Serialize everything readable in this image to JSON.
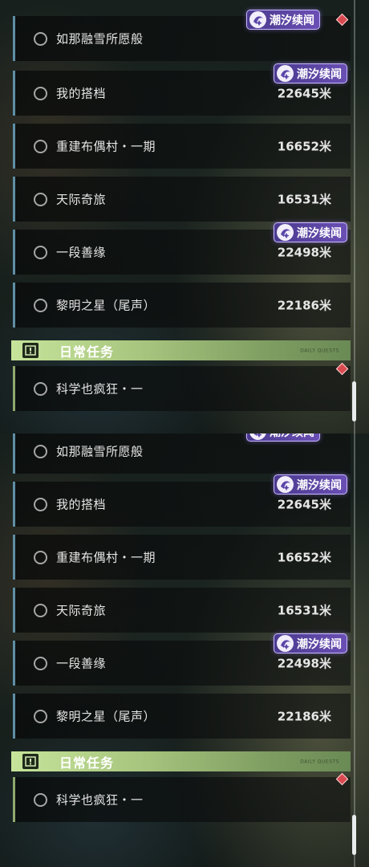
{
  "badge_label": "潮汐续闻",
  "distance_unit": "米",
  "quests": [
    {
      "title": "如那融雪所愿般",
      "distance": ""
    },
    {
      "title": "我的搭档",
      "distance": "22645"
    },
    {
      "title": "重建布偶村・一期",
      "distance": "16652"
    },
    {
      "title": "天际奇旅",
      "distance": "16531"
    },
    {
      "title": "一段善缘",
      "distance": "22498"
    },
    {
      "title": "黎明之星（尾声）",
      "distance": "22186"
    }
  ],
  "daily_section": {
    "title": "日常任务",
    "tag": "DAILY QUESTS"
  },
  "daily_quests": [
    {
      "title": "科学也疯狂・一"
    }
  ],
  "colors": {
    "main_quest_accent": "#5f8fa6",
    "daily_accent": "#8fa96e",
    "badge_purple": "#6a4fb4",
    "tracked_marker": "#d94a50"
  },
  "icons": [
    "tidal-story-logo-icon",
    "tracked-diamond-icon",
    "quest-circle-icon",
    "exclamation-icon"
  ]
}
